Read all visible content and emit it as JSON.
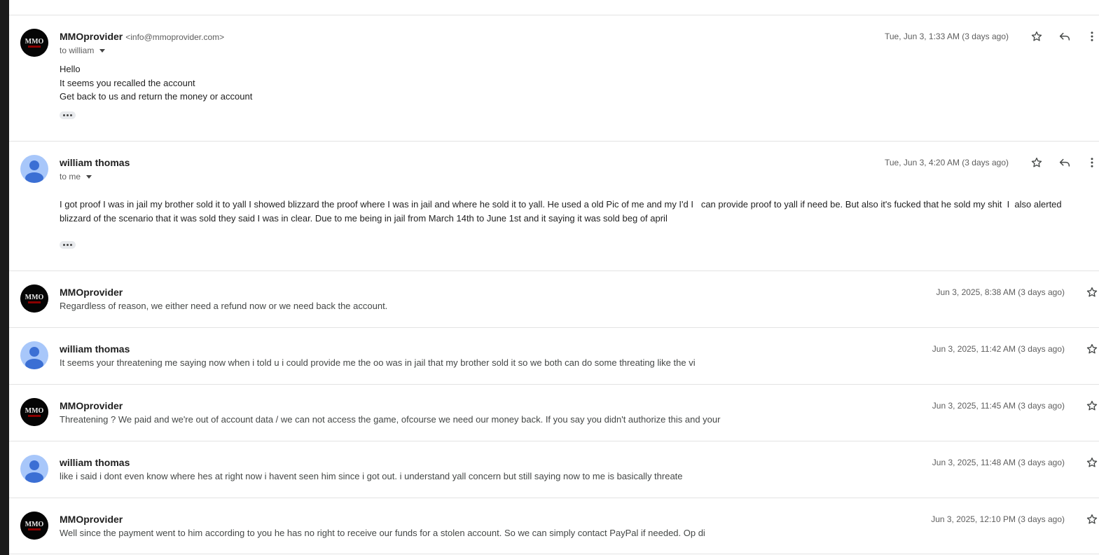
{
  "colors": {
    "accent": "#0b57d0",
    "avatar_person_bg": "#a8c7fa",
    "avatar_person_fg": "#3b6fd4"
  },
  "messages": [
    {
      "sender": "MMOprovider",
      "email": "<info@mmoprovider.com>",
      "recipient": "to william",
      "date": "Tue, Jun 3, 1:33 AM (3 days ago)",
      "body": [
        "Hello",
        "It seems you recalled the account",
        "Get back to us and return the money or account"
      ],
      "avatar": "mmoprovider-logo"
    },
    {
      "sender": "william thomas",
      "recipient": "to me",
      "date": "Tue, Jun 3, 4:20 AM (3 days ago)",
      "body": [
        "I got proof I was in jail my brother sold it to yall I showed blizzard the proof where I was in jail and where he sold it to yall. He used a old Pic of me and my I'd I   can provide proof to yall if need be. But also it's fucked that he sold my shit  I  also alerted blizzard of the scenario that it was sold they said I was in clear. Due to me being in jail from March 14th to June 1st and it saying it was sold beg of april"
      ],
      "avatar": "default-person-avatar"
    },
    {
      "sender": "MMOprovider",
      "date": "Jun 3, 2025, 8:38 AM (3 days ago)",
      "snippet": "Regardless of reason, we either need a refund now or we need back the account."
    },
    {
      "sender": "william thomas",
      "date": "Jun 3, 2025, 11:42 AM (3 days ago)",
      "snippet": "It seems your threatening me saying now when i told u i could provide me the oo was in jail that my brother sold it so we both can do some threating like the vi"
    },
    {
      "sender": "MMOprovider",
      "date": "Jun 3, 2025, 11:45 AM (3 days ago)",
      "snippet": "Threatening ? We paid and we're out of account data / we can not access the game, ofcourse we need our money back. If you say you didn't authorize this and your"
    },
    {
      "sender": "william thomas",
      "date": "Jun 3, 2025, 11:48 AM (3 days ago)",
      "snippet": "like i said i dont even know where hes at right now i havent seen him since i got out. i understand yall concern but still saying now to me is basically threate"
    },
    {
      "sender": "MMOprovider",
      "date": "Jun 3, 2025, 12:10 PM (3 days ago)",
      "snippet": "Well since the payment went to him according to you he has no right to receive our funds for a stolen account. So we can simply contact PayPal if needed. Op di"
    }
  ],
  "icons": {
    "star": "star-icon",
    "reply": "reply-icon",
    "more": "more-vert-icon",
    "expand": "expand-quoted-text"
  }
}
